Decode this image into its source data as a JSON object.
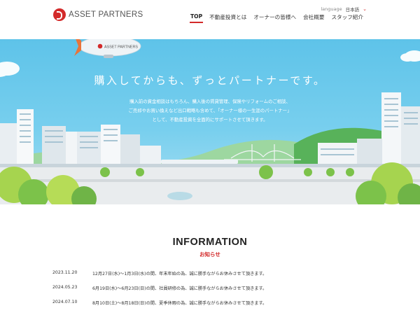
{
  "header": {
    "logo_text": "ASSET PARTNERS",
    "language_label": "language",
    "language_value": "日本語",
    "nav": [
      {
        "label": "TOP",
        "active": true
      },
      {
        "label": "不動産投資とは",
        "active": false
      },
      {
        "label": "オーナーの皆様へ",
        "active": false
      },
      {
        "label": "会社概要",
        "active": false
      },
      {
        "label": "スタッフ紹介",
        "active": false
      }
    ]
  },
  "hero": {
    "blimp_text": "ASSET PARTNERS",
    "title": "購入してからも、ずっとパートナーです。",
    "lines": [
      "購入前の資金相談はもちろん、購入後の賃貸管理、保険やリフォームのご相談、",
      "ご売却やお買い換えなど出口戦略も含めて、「オーナー様の一生涯のパートナー」",
      "として、不動産投資を全面的にサポートさせて頂きます。"
    ]
  },
  "info": {
    "title": "INFORMATION",
    "subtitle": "お知らせ",
    "items": [
      {
        "date": "2023.11.20",
        "text": "12月27日(水)～1月3日(水)の間、年末年始の為、誠に勝手ながらお休みさせて頂きます。"
      },
      {
        "date": "2024.05.23",
        "text": "6月19日(水)～6月23日(日)の間、社員研修の為、誠に勝手ながらお休みさせて頂きます。"
      },
      {
        "date": "2024.07.10",
        "text": "8月10日(土)～8月18日(日)の間、夏季休暇の為、誠に勝手ながらお休みさせて頂きます。"
      }
    ]
  },
  "colors": {
    "accent": "#d32a2a",
    "sky": "#6ac9ec",
    "grass": "#7cc24a"
  }
}
